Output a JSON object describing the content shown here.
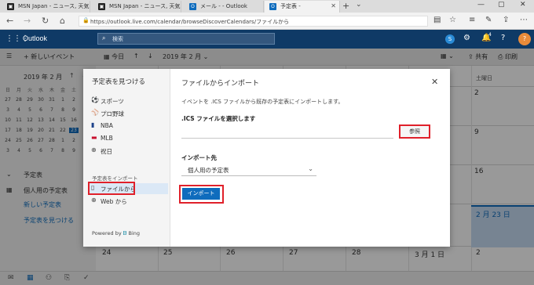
{
  "browser": {
    "tabs": [
      {
        "label": "MSN Japan - ニュース, 天気, ﾒ",
        "favicon": "MSN"
      },
      {
        "label": "MSN Japan - ニュース, 天気, ﾒ",
        "favicon": "MSN"
      },
      {
        "label": "メール -                   - Outlook",
        "favicon": "O"
      },
      {
        "label": "予定表 -",
        "favicon": "O"
      }
    ],
    "url": "https://outlook.live.com/calendar/browseDiscoverCalendars/ファイルから"
  },
  "header": {
    "brand": "Outlook",
    "search_placeholder": "検索",
    "skype_letter": "S",
    "badge_count": "4",
    "avatar_letter": "?"
  },
  "commands": {
    "new_event": "新しいイベント",
    "today": "今日",
    "month_nav": "2019 年 2 月",
    "share": "共有",
    "print": "印刷"
  },
  "mini_calendar": {
    "month_label": "2019 年 2 月",
    "dow": [
      "日",
      "月",
      "火",
      "水",
      "木",
      "金",
      "土"
    ],
    "rows": [
      [
        "27",
        "28",
        "29",
        "30",
        "31",
        "1",
        "2"
      ],
      [
        "3",
        "4",
        "5",
        "6",
        "7",
        "8",
        "9"
      ],
      [
        "10",
        "11",
        "12",
        "13",
        "14",
        "15",
        "16"
      ],
      [
        "17",
        "18",
        "19",
        "20",
        "21",
        "22",
        "23"
      ],
      [
        "24",
        "25",
        "26",
        "27",
        "28",
        "1",
        "2"
      ],
      [
        "3",
        "4",
        "5",
        "6",
        "7",
        "8",
        "9"
      ]
    ]
  },
  "left_nav": {
    "section": "予定表",
    "personal": "個人用の予定表",
    "new_calendar": "新しい予定表",
    "discover": "予定表を見つける"
  },
  "calendar": {
    "saturday_header": "土曜日",
    "sat_numbers": [
      "2",
      "9",
      "16",
      "2 月 23 日"
    ],
    "bottom_row": [
      "24",
      "25",
      "26",
      "27",
      "28",
      "3 月 1 日",
      "2"
    ]
  },
  "dialog": {
    "left_title": "予定表を見つける",
    "categories": [
      "スポーツ",
      "プロ野球",
      "NBA",
      "MLB",
      "祝日"
    ],
    "import_section": "予定表をインポート",
    "from_file": "ファイルから",
    "from_web": "Web から",
    "powered_by": "Powered by",
    "bing": "Bing",
    "right_title": "ファイルからインポート",
    "description": "イベントを .ICS ファイルから既存の予定表にインポートします。",
    "select_file_label": ".ICS ファイルを選択します",
    "browse": "参照",
    "import_target_label": "インポート先",
    "target_value": "個人用の予定表",
    "import_button": "インポート"
  },
  "colors": {
    "outlook_header": "#0f3a66",
    "accent": "#0f6cbd",
    "annotation_red": "#e0202a"
  }
}
